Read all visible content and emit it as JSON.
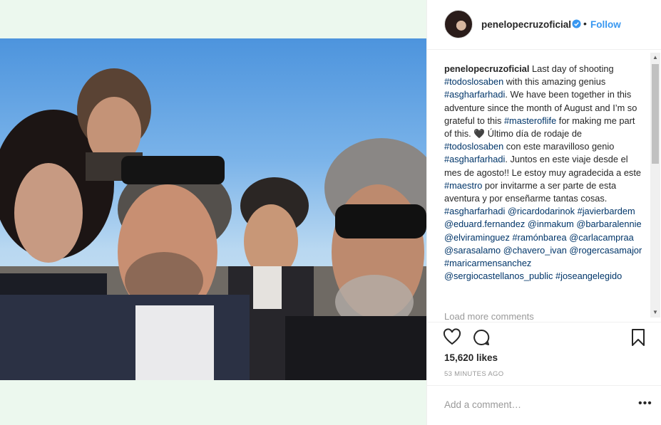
{
  "post": {
    "username": "penelopecruzoficial",
    "follow_label": "Follow",
    "dot": "•",
    "caption_user": "penelopecruzoficial",
    "caption_parts": [
      {
        "t": " Last day of shooting "
      },
      {
        "t": "#todoslosaben",
        "tag": true
      },
      {
        "t": " with this amazing genius "
      },
      {
        "t": "#asgharfarhadi",
        "tag": true
      },
      {
        "t": ". We have been together in this adventure since the month of August and I’m so grateful to this "
      },
      {
        "t": "#masteroflife",
        "tag": true
      },
      {
        "t": " for making me part of this. 🖤 Último día de rodaje de "
      },
      {
        "t": "#todoslosaben",
        "tag": true
      },
      {
        "t": " con este maravilloso genio "
      },
      {
        "t": "#asgharfarhadi",
        "tag": true
      },
      {
        "t": ". Juntos en este viaje desde el mes de agosto!! Le estoy muy agradecida a este "
      },
      {
        "t": "#maestro",
        "tag": true
      },
      {
        "t": " por invitarme a ser parte de esta aventura y por enseñarme tantas cosas. "
      },
      {
        "t": "#asgharfarhadi",
        "tag": true
      },
      {
        "t": " "
      },
      {
        "t": "@ricardodarinok",
        "tag": true
      },
      {
        "t": " "
      },
      {
        "t": "#javierbardem",
        "tag": true
      },
      {
        "t": " "
      },
      {
        "t": "@eduard.fernandez",
        "tag": true
      },
      {
        "t": " "
      },
      {
        "t": "@inmakum",
        "tag": true
      },
      {
        "t": " "
      },
      {
        "t": "@barbaralennie",
        "tag": true
      },
      {
        "t": " "
      },
      {
        "t": "@elviraminguez",
        "tag": true
      },
      {
        "t": " "
      },
      {
        "t": "#ramónbarea",
        "tag": true
      },
      {
        "t": " "
      },
      {
        "t": "@carlacampraa",
        "tag": true
      },
      {
        "t": " "
      },
      {
        "t": "@sarasalamo",
        "tag": true
      },
      {
        "t": " "
      },
      {
        "t": "@chavero_ivan",
        "tag": true
      },
      {
        "t": " "
      },
      {
        "t": "@rogercasamajor",
        "tag": true
      },
      {
        "t": " "
      },
      {
        "t": "#maricarmensanchez",
        "tag": true
      },
      {
        "t": " "
      },
      {
        "t": "@sergiocastellanos_public",
        "tag": true
      },
      {
        "t": " "
      },
      {
        "t": "#joseangelegido",
        "tag": true
      }
    ],
    "load_more": "Load more comments",
    "likes": "15,620 likes",
    "time": "53 MINUTES AGO",
    "add_comment_placeholder": "Add a comment…",
    "more_label": "•••"
  },
  "icons": {
    "heart": "heart-icon",
    "comment": "comment-icon",
    "bookmark": "bookmark-icon",
    "verified": "verified-badge-icon"
  },
  "colors": {
    "link": "#3897f0",
    "tag": "#003569",
    "text": "#262626",
    "muted": "#999999",
    "page_bg": "#ecf8ee"
  }
}
